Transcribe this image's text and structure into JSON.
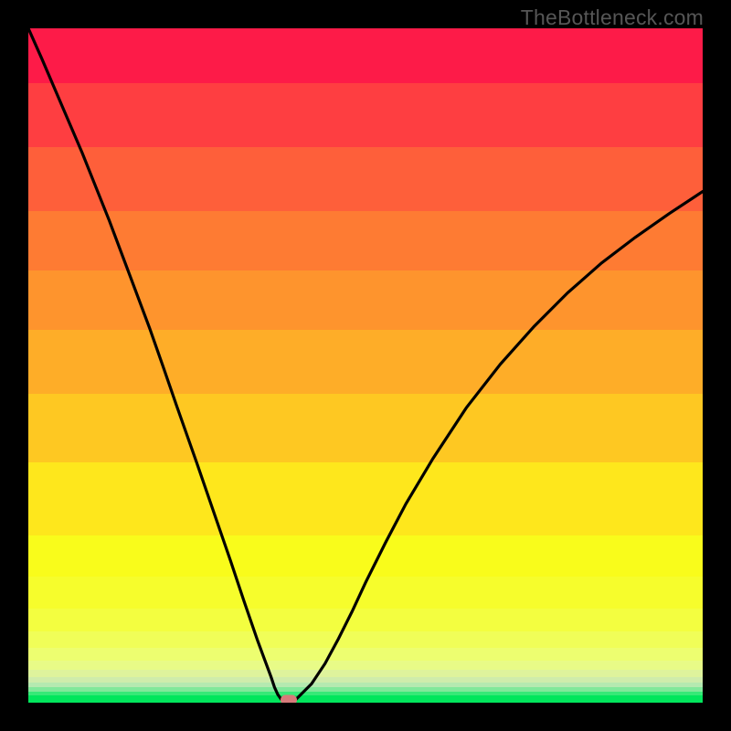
{
  "watermark": {
    "text": "TheBottleneck.com"
  },
  "colors": {
    "band_00": "#fd1b48",
    "band_01": "#fe3e41",
    "band_02": "#fe5f3a",
    "band_03": "#fe7b33",
    "band_04": "#fe942d",
    "band_05": "#fead28",
    "band_06": "#fec822",
    "band_07": "#fee71c",
    "band_08": "#f9fc1b",
    "band_09": "#f6fd2c",
    "band_10": "#f3fe40",
    "band_11": "#f0fe58",
    "band_12": "#edfe70",
    "band_13": "#e8fb87",
    "band_14": "#def39c",
    "band_15": "#cfecab",
    "band_16": "#b5e9b0",
    "band_17": "#81e89a",
    "band_18": "#37e977",
    "band_green": "#02e65c",
    "curve_stroke": "#000000",
    "marker_fill": "#d77a7a"
  },
  "chart_data": {
    "type": "line",
    "title": "",
    "xlabel": "",
    "ylabel": "",
    "xlim": [
      0,
      1
    ],
    "ylim": [
      0,
      1
    ],
    "x": [
      0.0,
      0.02,
      0.05,
      0.08,
      0.1,
      0.12,
      0.15,
      0.18,
      0.2,
      0.22,
      0.25,
      0.28,
      0.3,
      0.32,
      0.34,
      0.35,
      0.36,
      0.365,
      0.37,
      0.375,
      0.38,
      0.385,
      0.39,
      0.395,
      0.4,
      0.42,
      0.44,
      0.46,
      0.48,
      0.5,
      0.53,
      0.56,
      0.6,
      0.65,
      0.7,
      0.75,
      0.8,
      0.85,
      0.9,
      0.95,
      1.0
    ],
    "values": [
      1.0,
      0.955,
      0.885,
      0.815,
      0.765,
      0.715,
      0.635,
      0.555,
      0.498,
      0.44,
      0.355,
      0.268,
      0.21,
      0.15,
      0.092,
      0.065,
      0.038,
      0.023,
      0.012,
      0.005,
      0.002,
      0.0,
      0.0,
      0.003,
      0.008,
      0.028,
      0.058,
      0.095,
      0.135,
      0.178,
      0.238,
      0.295,
      0.362,
      0.438,
      0.502,
      0.558,
      0.608,
      0.652,
      0.69,
      0.725,
      0.758
    ],
    "minimum": {
      "x": 0.386,
      "y": 0.0
    },
    "legend": [],
    "grid": false
  }
}
